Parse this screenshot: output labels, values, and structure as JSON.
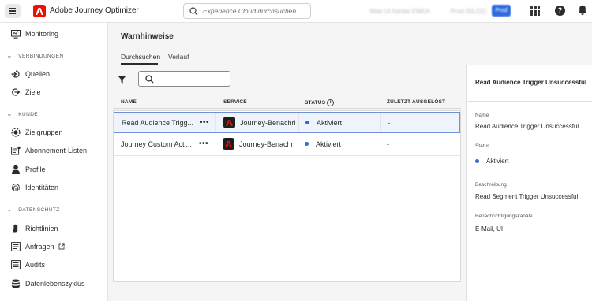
{
  "app": {
    "title": "Adobe Journey Optimizer",
    "org_name": "Web UI Adobe EMEA",
    "sandbox": "Prod (NLD2)",
    "sandbox_badge": "Prod"
  },
  "search": {
    "placeholder": "Experience Cloud durchsuchen ..."
  },
  "sidebar": {
    "monitoring": "Monitoring",
    "sections": {
      "verbindungen": "VERBINDUNGEN",
      "kunde": "KUNDE",
      "datenschutz": "DATENSCHUTZ"
    },
    "items": {
      "quellen": "Quellen",
      "ziele": "Ziele",
      "zielgruppen": "Zielgruppen",
      "abonnement": "Abonnement-Listen",
      "profile": "Profile",
      "identitaeten": "Identitäten",
      "richtlinien": "Richtlinien",
      "anfragen": "Anfragen",
      "audits": "Audits",
      "datenlebenszyklus": "Datenlebenszyklus"
    }
  },
  "main": {
    "title": "Warnhinweise",
    "tabs": [
      "Durchsuchen",
      "Verlauf"
    ],
    "columns": {
      "name": "NAME",
      "service": "SERVICE",
      "status": "STATUS",
      "last_triggered": "ZULETZT AUSGELÖST"
    },
    "rows": [
      {
        "name": "Read Audience Trigg...",
        "service": "Journey-Benachri",
        "status": "Aktiviert",
        "last": "-",
        "selected": true
      },
      {
        "name": "Journey Custom Acti...",
        "service": "Journey-Benachri",
        "status": "Aktiviert",
        "last": "-",
        "selected": false
      }
    ],
    "more_label": "•••"
  },
  "detail": {
    "title": "Read Audience Trigger Unsuccessful",
    "name_label": "Name",
    "name_value": "Read Audience Trigger Unsuccessful",
    "status_label": "Status",
    "status_value": "Aktiviert",
    "description_label": "Beschreibung",
    "description_value": "Read Segment Trigger Unsuccessful",
    "channels_label": "Benachrichtigungskanäle",
    "channels_value": "E-Mail, UI"
  },
  "colors": {
    "brand_red": "#eb1000",
    "accent_blue": "#2f6bdc",
    "selected_row_bg": "#eef3fc",
    "main_bg": "#f5f5f5"
  },
  "icons": {
    "menu": "hamburger-icon",
    "search": "search-icon",
    "apps": "apps-grid-icon",
    "help": "help-icon",
    "notifications": "bell-icon",
    "filter": "filter-icon",
    "info": "info-icon"
  }
}
